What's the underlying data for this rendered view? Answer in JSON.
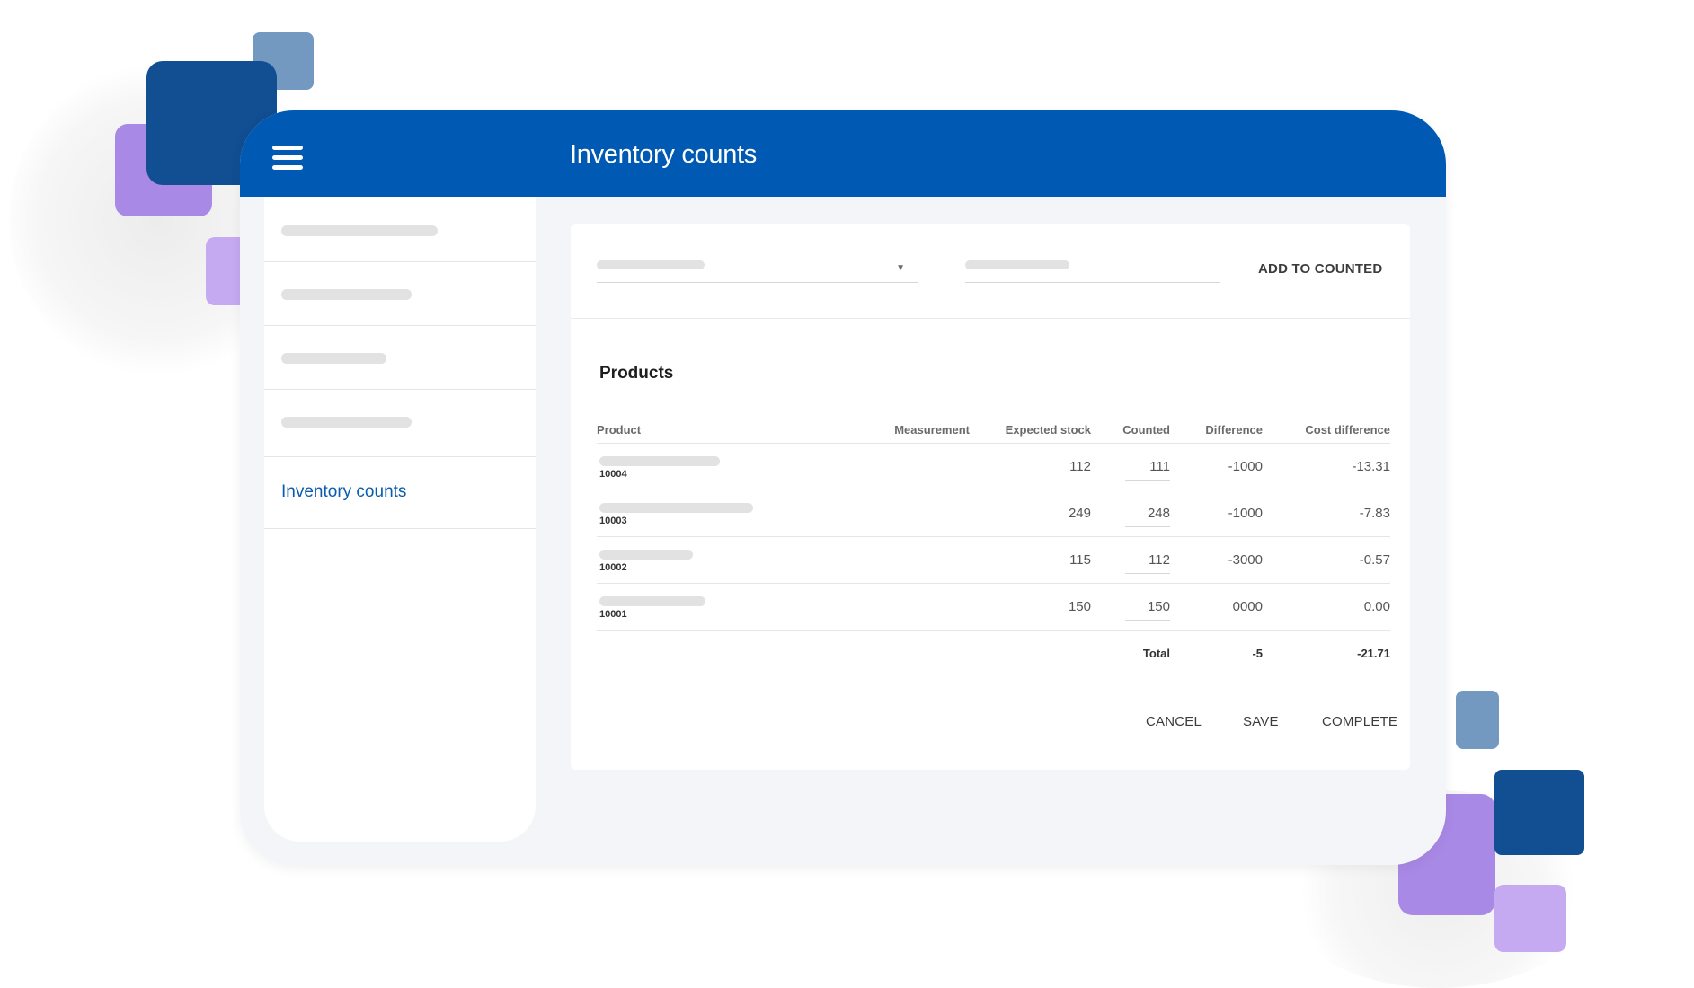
{
  "header": {
    "title": "Inventory counts"
  },
  "sidebar": {
    "items": [
      {
        "label": ""
      },
      {
        "label": ""
      },
      {
        "label": ""
      },
      {
        "label": ""
      },
      {
        "label": "Inventory counts",
        "active": true
      }
    ]
  },
  "filters": {
    "select_value": "",
    "search_value": "",
    "add_button": "ADD TO COUNTED"
  },
  "products": {
    "title": "Products",
    "columns": [
      "Product",
      "Measurement",
      "Expected stock",
      "Counted",
      "Difference",
      "Cost difference"
    ],
    "rows": [
      {
        "name": "",
        "code": "10004",
        "measurement": "",
        "expected": "112",
        "counted": "111",
        "difference": "-1000",
        "cost_difference": "-13.31"
      },
      {
        "name": "",
        "code": "10003",
        "measurement": "",
        "expected": "249",
        "counted": "248",
        "difference": "-1000",
        "cost_difference": "-7.83"
      },
      {
        "name": "",
        "code": "10002",
        "measurement": "",
        "expected": "115",
        "counted": "112",
        "difference": "-3000",
        "cost_difference": "-0.57"
      },
      {
        "name": "",
        "code": "10001",
        "measurement": "",
        "expected": "150",
        "counted": "150",
        "difference": "0000",
        "cost_difference": "0.00"
      }
    ],
    "total": {
      "label": "Total",
      "difference": "-5",
      "cost_difference": "-21.71"
    }
  },
  "actions": {
    "cancel": "CANCEL",
    "save": "SAVE",
    "complete": "COMPLETE"
  },
  "colors": {
    "brand": "#0059b3",
    "decor_dark_blue": "#114e92",
    "decor_light_blue": "#7399c1",
    "decor_purple": "#a989e6",
    "decor_light_purple": "#c5a9f1"
  },
  "icons": {
    "menu": "hamburger-menu-icon",
    "dropdown": "caret-down-icon"
  }
}
